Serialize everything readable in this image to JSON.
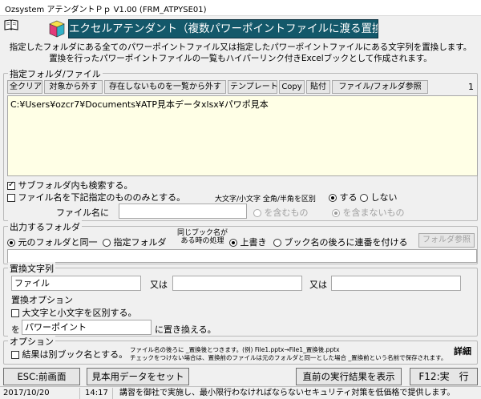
{
  "window": {
    "title": "Ozsystem アテンダントＰｐ V1.00 (FRM_ATPYSE01)"
  },
  "icons": {
    "book": "book-icon",
    "logo": "cube-logo-icon"
  },
  "banner": {
    "title": "エクセルアテンダント（複数パワーポイントファイルに渡る置換）"
  },
  "description": {
    "line1": "指定したフォルダにある全てのパワーポイントファイル又は指定したパワーポイントファイルにある文字列を置換します。",
    "line2": "置換を行ったパワーポイントファイルの一覧もハイパーリンク付きExcelブックとして作成されます。"
  },
  "target": {
    "group_label": "指定フォルダ/ファイル",
    "buttons": {
      "clear_all": "全クリア",
      "remove_selected": "対象から外す",
      "remove_missing": "存在しないものを一覧から外す",
      "template": "テンプレート",
      "copy": "Copy",
      "paste": "貼付",
      "browse": "ファイル/フォルダ参照"
    },
    "count": "1",
    "list_items": [
      "C:¥Users¥ozcr7¥Documents¥ATP見本データxlsx¥パワポ見本"
    ],
    "include_subfolders": {
      "label": "サブフォルダ内も検索する。",
      "checked": true
    },
    "filename_only": {
      "label": "ファイル名を下記指定のもののみとする。",
      "checked": false
    },
    "case_label": "大文字/小文字 全角/半角を区別",
    "case_yes": "する",
    "case_no": "しない",
    "filename_label": "ファイル名に",
    "filename_value": "",
    "contains": "を含むもの",
    "not_contains": "を含まないもの"
  },
  "output": {
    "group_label": "出力するフォルダ",
    "same_folder": "元のフォルダと同一",
    "specified_folder": "指定フォルダ",
    "same_name_label_1": "同じブック名が",
    "same_name_label_2": "ある時の処理",
    "overwrite": "上書き",
    "append_number": "ブック名の後ろに連番を付ける",
    "browse": "フォルダ参照",
    "folder_path": ""
  },
  "replace": {
    "group_label": "置換文字列",
    "search_1": "ファイル",
    "or_1": "又は",
    "search_2": "",
    "or_2": "又は",
    "search_3": "",
    "options_label": "置換オプション",
    "case_sensitive": {
      "label": "大文字と小文字を区別する。",
      "checked": false
    },
    "to_prefix": "を",
    "replacement": "パワーポイント",
    "replace_suffix": "に置き換える。"
  },
  "options": {
    "group_label": "オプション",
    "separate_book": {
      "label": "結果は別ブック名とする。",
      "checked": false
    },
    "note_1": "ファイル名の後ろに _置換後とつきます。(例) File1.pptx→File1_置換後.pptx",
    "note_2": "チェックをつけない場合は、置換前のファイルは元のフォルダと同一とした場合 _置換前という名前で保存されます。",
    "details": "詳細"
  },
  "footer": {
    "esc": "ESC:前画面",
    "sample": "見本用データをセット",
    "last_result": "直前の実行結果を表示",
    "run": "F12:実　行"
  },
  "status_bar": {
    "date": "2017/10/20",
    "time": "14:17",
    "message": "講習を御社で実施し、最小限行わなければならないセキュリティ対策を低価格で提供します。"
  }
}
